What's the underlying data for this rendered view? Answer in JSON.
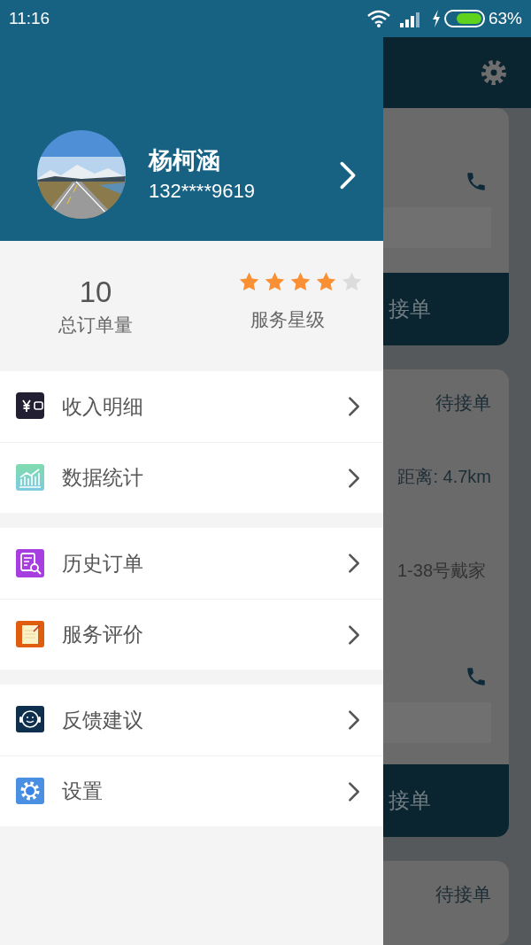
{
  "status_bar": {
    "time": "11:16",
    "battery": "63%"
  },
  "profile": {
    "name": "杨柯涵",
    "phone": "132****9619"
  },
  "stats": {
    "orders": {
      "value": "10",
      "label": "总订单量"
    },
    "rating": {
      "stars": 4,
      "label": "服务星级"
    }
  },
  "menu_groups": [
    [
      {
        "kind": "wallet",
        "label": "收入明细"
      },
      {
        "kind": "chart",
        "label": "数据统计"
      }
    ],
    [
      {
        "kind": "history",
        "label": "历史订单"
      },
      {
        "kind": "review",
        "label": "服务评价"
      }
    ],
    [
      {
        "kind": "feedback",
        "label": "反馈建议"
      },
      {
        "kind": "settings",
        "label": "设置"
      }
    ]
  ],
  "background": {
    "cards": [
      {
        "button": "接单"
      },
      {
        "status": "待接单",
        "distance": "距离: 4.7km",
        "address": "1-38号戴家",
        "button": "接单"
      },
      {
        "status": "待接单"
      }
    ]
  }
}
